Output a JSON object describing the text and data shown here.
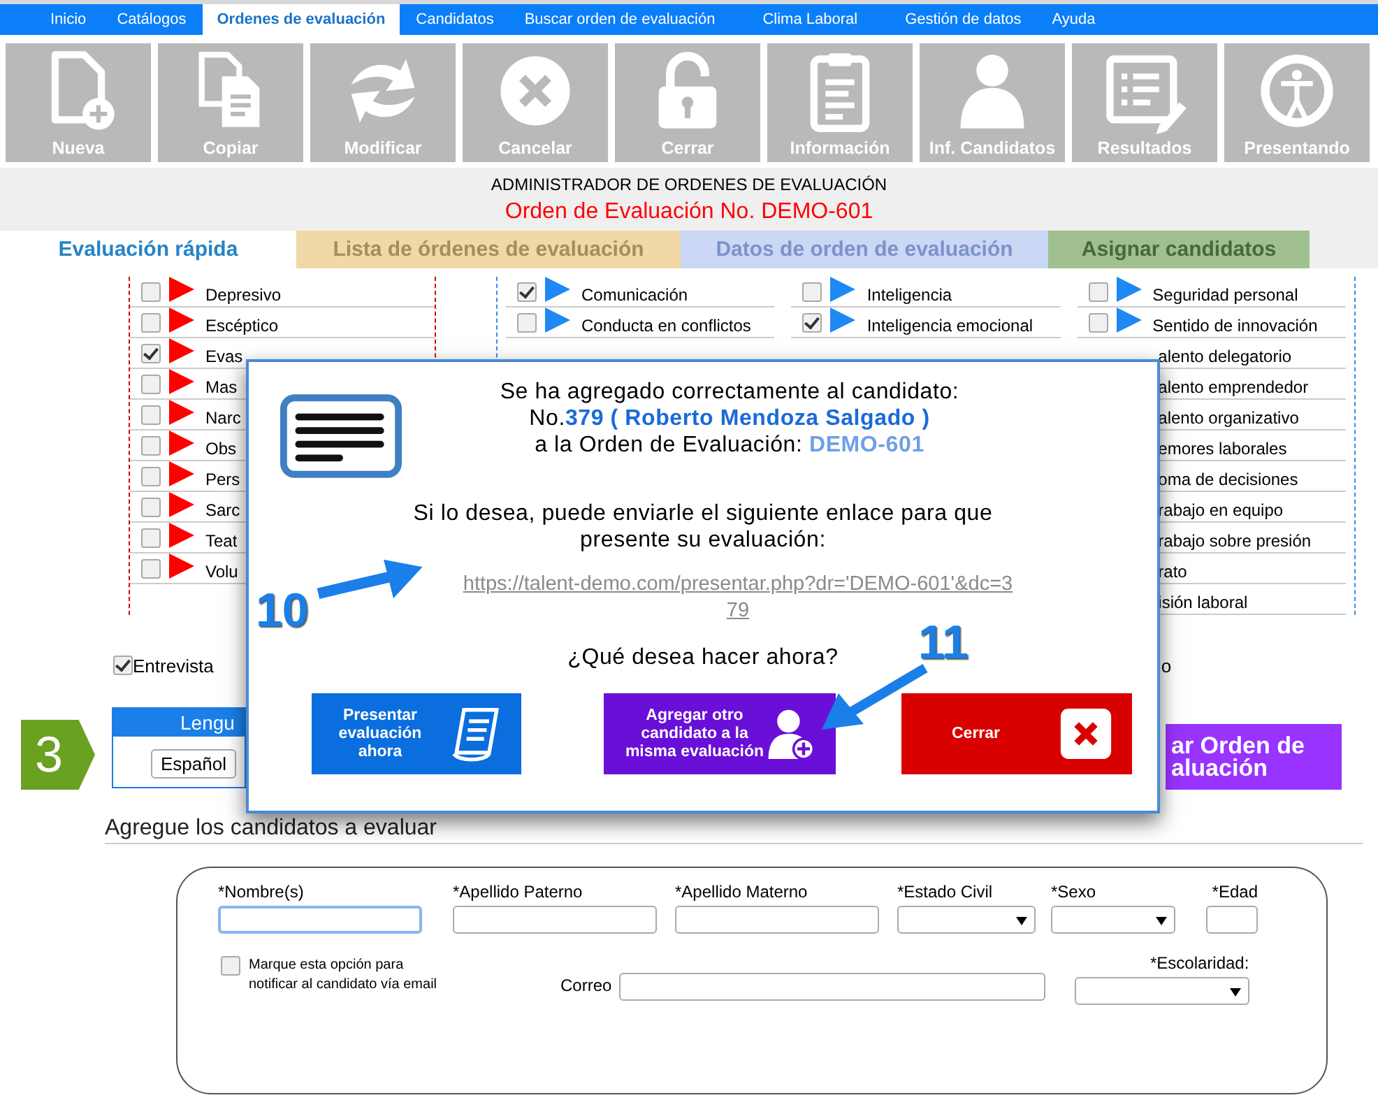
{
  "menu": [
    {
      "label": "Inicio",
      "selected": false
    },
    {
      "label": "Catálogos",
      "selected": false
    },
    {
      "label": "Ordenes de evaluación",
      "selected": true
    },
    {
      "label": "Candidatos",
      "selected": false
    },
    {
      "label": "Buscar orden de evaluación",
      "selected": false
    },
    {
      "label": "Clima Laboral",
      "selected": false
    },
    {
      "label": "Gestión de datos",
      "selected": false
    },
    {
      "label": "Ayuda",
      "selected": false
    }
  ],
  "toolbar": [
    {
      "label": "Nueva",
      "kind": "new"
    },
    {
      "label": "Copiar",
      "kind": "copy"
    },
    {
      "label": "Modificar",
      "kind": "modify"
    },
    {
      "label": "Cancelar",
      "kind": "cancel"
    },
    {
      "label": "Cerrar",
      "kind": "lock"
    },
    {
      "label": "Información",
      "kind": "info"
    },
    {
      "label": "Inf. Candidatos",
      "kind": "person"
    },
    {
      "label": "Resultados",
      "kind": "results"
    },
    {
      "label": "Presentando",
      "kind": "access"
    }
  ],
  "header": {
    "title": "ADMINISTRADOR DE ORDENES DE EVALUACIÓN",
    "order": "Orden de Evaluación No. DEMO-601"
  },
  "tabs": [
    {
      "label": "Evaluación rápida",
      "selected": true
    },
    {
      "label": "Lista de órdenes de evaluación",
      "selected": false
    },
    {
      "label": "Datos de orden de evaluación",
      "selected": false
    },
    {
      "label": "Asignar candidatos",
      "selected": false
    }
  ],
  "trait_columns": [
    {
      "color": "#ff0000",
      "items": [
        {
          "label": "Depresivo",
          "checked": false
        },
        {
          "label": "Escéptico",
          "checked": false
        },
        {
          "label": "Evas",
          "checked": true
        },
        {
          "label": "Mas",
          "checked": false
        },
        {
          "label": "Narc",
          "checked": false
        },
        {
          "label": "Obs",
          "checked": false
        },
        {
          "label": "Pers",
          "checked": false
        },
        {
          "label": "Sarc",
          "checked": false
        },
        {
          "label": "Teat",
          "checked": false
        },
        {
          "label": "Volu",
          "checked": false
        }
      ]
    },
    {
      "color": "#1e88f5",
      "items": [
        {
          "label": "Comunicación",
          "checked": true
        },
        {
          "label": "Conducta en conflictos",
          "checked": false
        }
      ]
    },
    {
      "color": "#1e88f5",
      "items": [
        {
          "label": "Inteligencia",
          "checked": false
        },
        {
          "label": "Inteligencia emocional",
          "checked": true
        }
      ]
    },
    {
      "color": "#1e88f5",
      "items": [
        {
          "label": "Seguridad personal",
          "checked": false
        },
        {
          "label": "Sentido de innovación",
          "checked": false
        }
      ],
      "partial_items": [
        "alento delegatorio",
        "alento emprendedor",
        "alento organizativo",
        "emores laborales",
        "oma de decisiones",
        "rabajo en equipo",
        "rabajo sobre presión",
        "rato",
        "isión laboral"
      ]
    }
  ],
  "interview": {
    "label": "Entrevista",
    "checked": true
  },
  "cut_text": "o",
  "language": {
    "title": "Lengu",
    "value": "Español"
  },
  "step": "3",
  "save_button": {
    "lines": [
      "ar Orden de",
      "aluación"
    ]
  },
  "section_title": "Agregue los candidatos a evaluar",
  "form": {
    "fields": [
      {
        "label": "*Nombre(s)",
        "kind": "text"
      },
      {
        "label": "*Apellido Paterno",
        "kind": "text"
      },
      {
        "label": "*Apellido Materno",
        "kind": "text"
      },
      {
        "label": "*Estado Civil",
        "kind": "select"
      },
      {
        "label": "*Sexo",
        "kind": "select"
      },
      {
        "label": "*Edad",
        "kind": "text"
      }
    ],
    "notify": {
      "label": "Marque esta opción para notificar al candidato vía email",
      "checked": false
    },
    "email_label": "Correo",
    "schooling_label": "*Escolaridad:"
  },
  "modal": {
    "message": "Se ha agregado correctamente al candidato:",
    "candidate": "No.**379 ( Roberto Mendoza Salgado )**",
    "order": "a la Orden de Evaluación: **DEMO-601**",
    "link_intro": "Si lo desea, puede enviarle el siguiente enlace para que presente su evaluación:",
    "link": "https://talent-demo.com/presentar.php?dr='DEMO-601'&dc=379",
    "question": "¿Qué desea hacer ahora?",
    "buttons": [
      {
        "label": "Presentar evaluación ahora",
        "kind": "present"
      },
      {
        "label": "Agregar otro candidato a la misma evaluación",
        "kind": "add"
      },
      {
        "label": "Cerrar",
        "kind": "close"
      }
    ]
  },
  "annotations": [
    "10",
    "11"
  ]
}
